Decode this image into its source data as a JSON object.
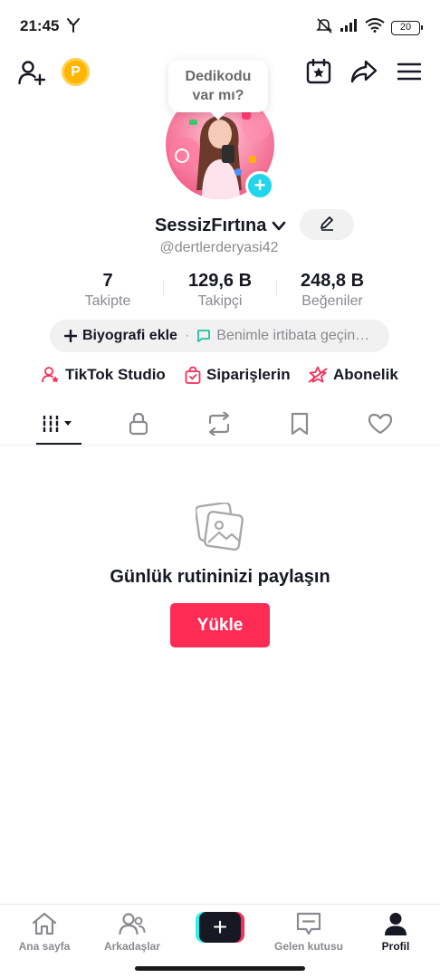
{
  "status": {
    "time": "21:45",
    "battery": "20"
  },
  "bubble": {
    "line1": "Dedikodu",
    "line2": "var mı?"
  },
  "coin_label": "P",
  "profile": {
    "name": "SessizFırtına",
    "handle": "@dertlerderyasi42",
    "stats": [
      {
        "value": "7",
        "label": "Takipte"
      },
      {
        "value": "129,6 B",
        "label": "Takipçi"
      },
      {
        "value": "248,8 B",
        "label": "Beğeniler"
      }
    ]
  },
  "bio": {
    "add_label": "Biyografi ekle",
    "separator": "·",
    "contact_label": "Benimle irtibata geçin…"
  },
  "links": [
    {
      "label": "TikTok Studio"
    },
    {
      "label": "Siparişlerin"
    },
    {
      "label": "Abonelik"
    }
  ],
  "tabs": [
    {
      "icon": "videos-grid-icon",
      "active": true
    },
    {
      "icon": "lock-icon",
      "active": false
    },
    {
      "icon": "repost-icon",
      "active": false
    },
    {
      "icon": "bookmark-icon",
      "active": false
    },
    {
      "icon": "heart-icon",
      "active": false
    }
  ],
  "empty_state": {
    "title": "Günlük rutininizi paylaşın",
    "button": "Yükle"
  },
  "bottom_nav": [
    {
      "label": "Ana sayfa",
      "icon": "home-icon"
    },
    {
      "label": "Arkadaşlar",
      "icon": "friends-icon"
    },
    {
      "label": "+",
      "icon": "create-icon"
    },
    {
      "label": "Gelen kutusu",
      "icon": "inbox-icon"
    },
    {
      "label": "Profil",
      "icon": "profile-icon",
      "active": true
    }
  ],
  "colors": {
    "accent": "#fe2c55",
    "cyan": "#20d5ec",
    "text": "#161823",
    "muted": "#8a8b91"
  }
}
